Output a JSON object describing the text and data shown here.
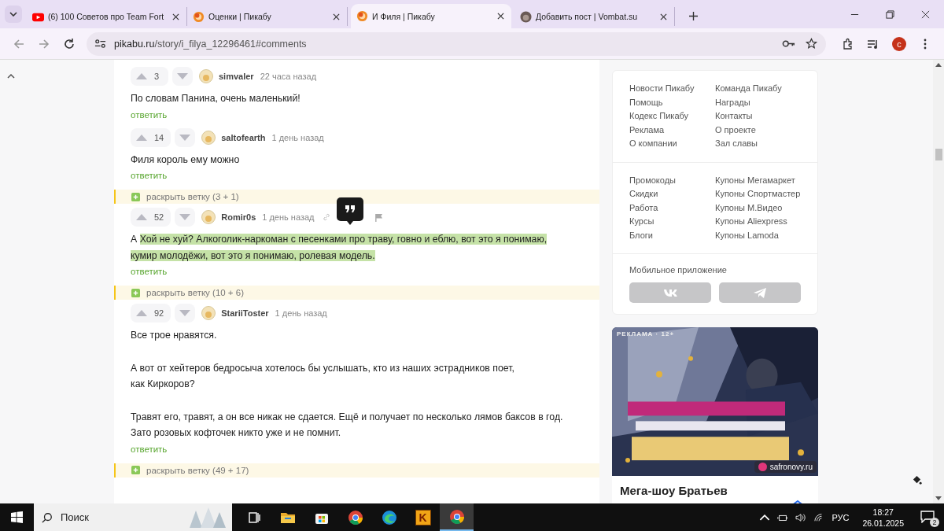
{
  "tabs": [
    {
      "kind": "youtube",
      "title": "(6) 100 Советов про Team Fort",
      "selected": false
    },
    {
      "kind": "pikabu",
      "title": "Оценки | Пикабу",
      "selected": false
    },
    {
      "kind": "pikabu",
      "title": "И Филя | Пикабу",
      "selected": true
    },
    {
      "kind": "vombat",
      "title": "Добавить пост | Vombat.su",
      "selected": false
    }
  ],
  "toolbar": {
    "url_host": "pikabu.ru",
    "url_path": "/story/i_filya_12296461#comments",
    "profile_initial": "с"
  },
  "feed": [
    {
      "kind": "comment",
      "votes": "3",
      "author": "simvaler",
      "time": "22 часа назад",
      "hovered": false,
      "paragraphs": [
        [
          [
            {
              "text": "По словам Панина, очень маленький!",
              "selected": false
            }
          ]
        ]
      ],
      "reply": "ответить"
    },
    {
      "kind": "comment",
      "votes": "14",
      "author": "saltofearth",
      "time": "1 день назад",
      "hovered": false,
      "paragraphs": [
        [
          [
            {
              "text": "Филя король ему можно",
              "selected": false
            }
          ]
        ]
      ],
      "reply": "ответить"
    },
    {
      "kind": "expand",
      "label": "раскрыть ветку (3 + 1)"
    },
    {
      "kind": "comment",
      "votes": "52",
      "author": "Romir0s",
      "time": "1 день назад",
      "hovered": true,
      "paragraphs": [
        [
          [
            {
              "text": "А ",
              "selected": false
            },
            {
              "text": "Хой не хуй? Алкоголик-наркоман с песенками про траву, говно и еблю, вот это я понимаю,",
              "selected": true
            }
          ],
          [
            {
              "text": "кумир молодёжи, вот это я понимаю, ролевая модель.",
              "selected": true
            }
          ]
        ]
      ],
      "reply": "ответить"
    },
    {
      "kind": "expand",
      "label": "раскрыть ветку (10 + 6)"
    },
    {
      "kind": "comment",
      "votes": "92",
      "author": "StariiToster",
      "time": "1 день назад",
      "hovered": false,
      "paragraphs": [
        [
          [
            {
              "text": "Все трое нравятся.",
              "selected": false
            }
          ]
        ],
        [
          [
            {
              "text": "А вот от хейтеров бедросыча хотелось бы услышать, кто из наших эстрадников поет,",
              "selected": false
            }
          ],
          [
            {
              "text": "как Киркоров?",
              "selected": false
            }
          ]
        ],
        [
          [
            {
              "text": "Травят его, травят, а он все никак не сдается. Ещё и получает по несколько лямов баксов в год.",
              "selected": false
            }
          ],
          [
            {
              "text": "Зато розовых кофточек никто уже и не помнит.",
              "selected": false
            }
          ]
        ]
      ],
      "reply": "ответить"
    },
    {
      "kind": "expand",
      "label": "раскрыть ветку (49 + 17)"
    }
  ],
  "sidebar": {
    "link_groups": [
      {
        "columns": [
          [
            "Новости Пикабу",
            "Помощь",
            "Кодекс Пикабу",
            "Реклама",
            "О компании"
          ],
          [
            "Команда Пикабу",
            "Награды",
            "Контакты",
            "О проекте",
            "Зал славы"
          ]
        ]
      },
      {
        "columns": [
          [
            "Промокоды",
            "Скидки",
            "Работа",
            "Курсы",
            "Блоги"
          ],
          [
            "Купоны Мегамаркет",
            "Купоны Спортмастер",
            "Купоны М.Видео",
            "Купоны Aliexpress",
            "Купоны Lamoda"
          ]
        ]
      }
    ],
    "app_title": "Мобильное приложение",
    "app_buttons": [
      {
        "kind": "vk"
      },
      {
        "kind": "telegram"
      }
    ],
    "ad": {
      "label": "РЕКЛАМА · 12+",
      "source": "safronovy.ru",
      "title": "Мега-шоу Братьев"
    }
  },
  "taskbar": {
    "search_placeholder": "Поиск",
    "apps": [
      {
        "kind": "taskview",
        "selected": false
      },
      {
        "kind": "explorer",
        "selected": false
      },
      {
        "kind": "store",
        "selected": false
      },
      {
        "kind": "chrome",
        "selected": false
      },
      {
        "kind": "edge",
        "selected": false
      },
      {
        "kind": "letter",
        "glyph": "K",
        "selected": false
      },
      {
        "kind": "chrome",
        "selected": true
      }
    ],
    "language": "РУС",
    "time": "18:27",
    "date": "26.01.2025",
    "notifications": "2"
  }
}
